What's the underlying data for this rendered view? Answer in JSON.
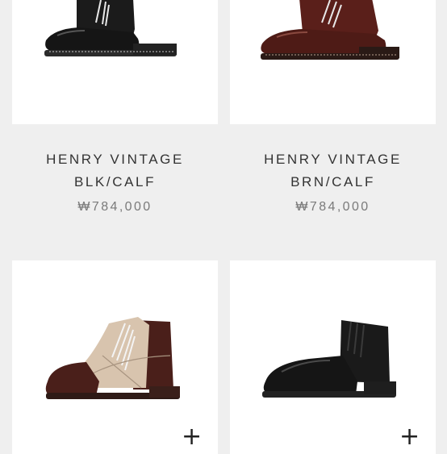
{
  "products": [
    {
      "name_line1": "HENRY VINTAGE",
      "name_line2": "BLK/CALF",
      "price": "₩784,000"
    },
    {
      "name_line1": "HENRY VINTAGE",
      "name_line2": "BRN/CALF",
      "price": "₩784,000"
    }
  ],
  "add_icon": "+",
  "colors": {
    "background": "#efefef",
    "card": "#ffffff",
    "black_leather": "#1b1b1b",
    "brown_leather": "#5a1f1a",
    "canvas": "#d8c4ae",
    "price_text": "#7a7a7a"
  },
  "icons": [
    "plus-icon"
  ]
}
